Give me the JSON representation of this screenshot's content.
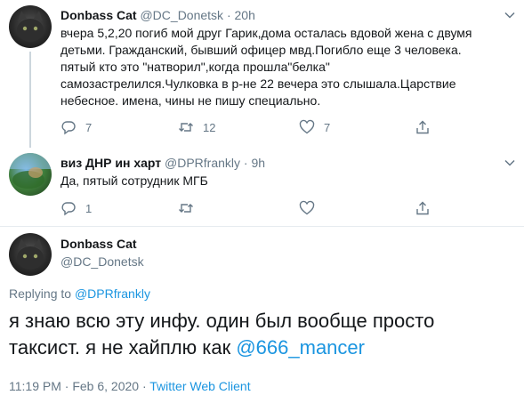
{
  "tweets": [
    {
      "name": "Donbass Cat",
      "handle": "@DC_Donetsk",
      "separator": "·",
      "time": "20h",
      "lines": [
        "вчера 5,2,20 погиб мой друг Гарик,дома осталась вдовой жена с двумя",
        "детьми. Гражданский, бывший офицер мвд.Погибло еще 3 человека.",
        "пятый кто это \"натворил\",когда прошла\"белка\"",
        "самозастрелился.Чулковка в р-не 22 вечера это слышала.Царствие",
        "небесное. имена, чины не пишу специально."
      ],
      "reply_count": "7",
      "retweet_count": "12",
      "like_count": "7"
    },
    {
      "name": "виз ДНР ин харт",
      "handle": "@DPRfrankly",
      "separator": "·",
      "time": "9h",
      "text": "Да, пятый сотрудник МГБ",
      "reply_count": "1"
    }
  ],
  "focused": {
    "name": "Donbass Cat",
    "handle": "@DC_Donetsk",
    "replying_prefix": "Replying to",
    "replying_to": "@DPRfrankly",
    "line1": "я знаю всю эту инфу. один был вообще просто",
    "line2_prefix": "таксист. я не хайплю как",
    "line2_mention": "@666_mancer",
    "timestamp": "11:19 PM · Feb 6, 2020 ·",
    "client": "Twitter Web Client"
  },
  "colors": {
    "accent": "#1b95e0",
    "secondary_text": "#657786",
    "divider": "#e6ecf0"
  },
  "icons": [
    "reply-icon",
    "retweet-icon",
    "like-icon",
    "share-icon",
    "chevron-down-icon"
  ]
}
